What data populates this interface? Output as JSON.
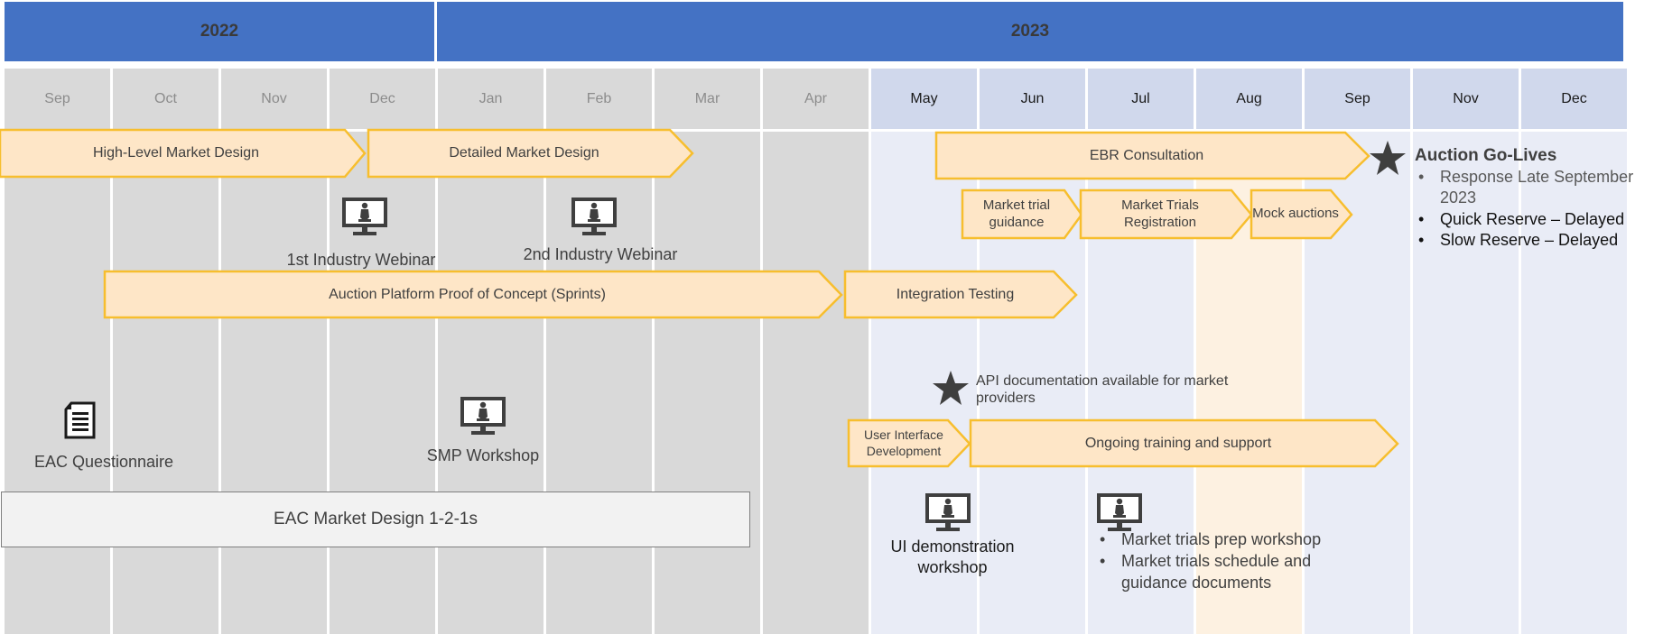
{
  "years": [
    {
      "label": "2022"
    },
    {
      "label": "2023"
    }
  ],
  "months": [
    "Sep",
    "Oct",
    "Nov",
    "Dec",
    "Jan",
    "Feb",
    "Mar",
    "Apr",
    "May",
    "Jun",
    "Jul",
    "Aug",
    "Sep",
    "Nov",
    "Dec"
  ],
  "colors": {
    "year_bar": "#4472C4",
    "past_bg": "#D9D9D9",
    "future_bg": "#E9ECF6",
    "future_header": "#D0D8EC",
    "highlight": "#FDF1E1",
    "arrow_fill": "#FEE6C7",
    "arrow_stroke": "#F7BE2E",
    "icon": "#3F3F3F"
  },
  "tasks": {
    "high_level": "High-Level Market Design",
    "detailed": "Detailed Market Design",
    "ebr": "EBR Consultation",
    "market_trial_guidance": "Market trial guidance",
    "market_trials_registration": "Market Trials Registration",
    "mock_auctions": "Mock auctions",
    "proof_of_concept": "Auction Platform Proof of Concept (Sprints)",
    "integration_testing": "Integration Testing",
    "ui_dev": "User Interface Development",
    "ongoing": "Ongoing training and support",
    "eac_1_2_1": "EAC Market Design 1-2-1s"
  },
  "events": {
    "webinar1": "1st Industry Webinar",
    "webinar2": "2nd Industry Webinar",
    "eac_questionnaire": "EAC Questionnaire",
    "smp_workshop": "SMP Workshop",
    "ui_demo_line1": "UI demonstration",
    "ui_demo_line2": "workshop",
    "api_doc": "API documentation available for market providers",
    "market_trials_list": [
      "Market trials prep workshop",
      "Market trials schedule and guidance documents"
    ]
  },
  "golive": {
    "title": "Auction Go-Lives",
    "items": [
      "Response  Late September 2023",
      "Quick Reserve – Delayed",
      "Slow Reserve – Delayed"
    ]
  },
  "icons": {
    "monitor": "presenter-monitor-icon",
    "document": "document-icon",
    "star": "star-icon"
  }
}
